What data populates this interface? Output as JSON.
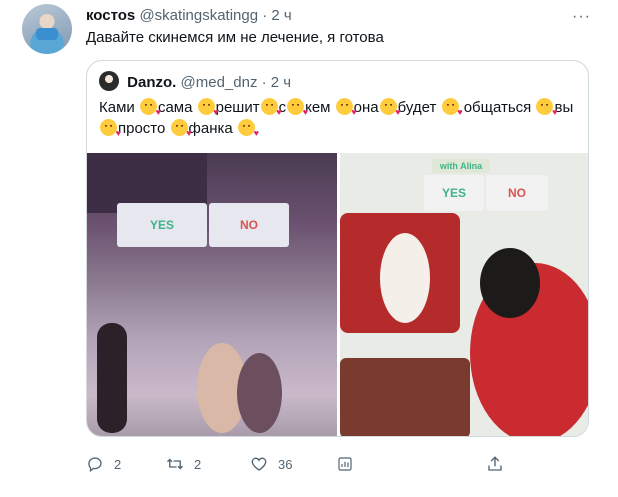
{
  "tweet": {
    "display_name": "костоs",
    "handle": "@skatingskatingg",
    "separator": "·",
    "time": "2 ч",
    "more_label": "···",
    "text": "Давайте скинемся им не лечение, я готова"
  },
  "quoted": {
    "display_name": "Danzo.",
    "handle": "@med_dnz",
    "separator": "·",
    "time": "2 ч",
    "words": [
      "Ками",
      "сама",
      "решит",
      "с",
      "кем",
      "она",
      "будет",
      "общаться",
      "вы",
      "просто",
      "фанка"
    ],
    "images": {
      "left": {
        "poll_yes": "YES",
        "poll_no": "NO"
      },
      "right": {
        "caption": "with Alina",
        "poll_yes": "YES",
        "poll_no": "NO"
      }
    }
  },
  "actions": {
    "replies": "2",
    "retweets": "2",
    "likes": "36"
  },
  "colors": {
    "muted": "#536471",
    "border": "#cfd9de",
    "yes": "#40b38a",
    "no": "#d9534f"
  }
}
